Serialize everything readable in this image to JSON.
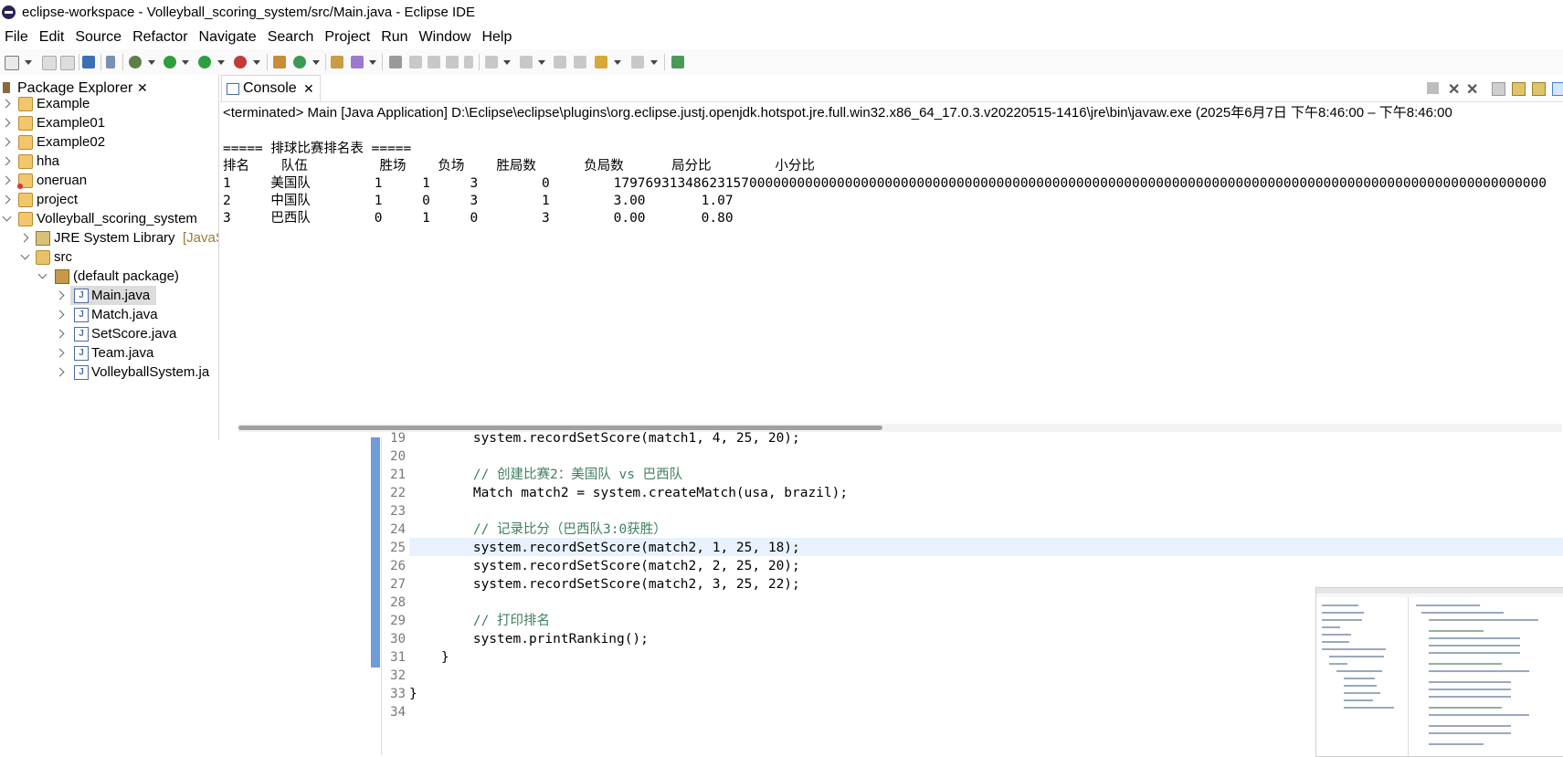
{
  "window": {
    "title": "eclipse-workspace - Volleyball_scoring_system/src/Main.java - Eclipse IDE"
  },
  "menu": [
    "File",
    "Edit",
    "Source",
    "Refactor",
    "Navigate",
    "Search",
    "Project",
    "Run",
    "Window",
    "Help"
  ],
  "package_explorer": {
    "tab_label": "Package Explorer",
    "items": [
      {
        "label": "Example",
        "icon": "project-icon"
      },
      {
        "label": "Example01",
        "icon": "project-icon"
      },
      {
        "label": "Example02",
        "icon": "project-icon"
      },
      {
        "label": "hha",
        "icon": "project-icon"
      },
      {
        "label": "oneruan",
        "icon": "project-error-icon"
      },
      {
        "label": "project",
        "icon": "project-icon"
      },
      {
        "label": "Volleyball_scoring_system",
        "icon": "project-icon"
      },
      {
        "label": "JRE System Library",
        "suffix": "[JavaS",
        "icon": "library-icon"
      },
      {
        "label": "src",
        "icon": "source-folder-icon"
      },
      {
        "label": "(default package)",
        "icon": "package-icon"
      },
      {
        "label": "Main.java",
        "icon": "java-file-icon"
      },
      {
        "label": "Match.java",
        "icon": "java-file-icon"
      },
      {
        "label": "SetScore.java",
        "icon": "java-file-icon"
      },
      {
        "label": "Team.java",
        "icon": "java-file-icon"
      },
      {
        "label": "VolleyballSystem.ja",
        "icon": "java-file-icon"
      }
    ]
  },
  "console": {
    "tab_label": "Console",
    "terminated": "<terminated> Main [Java Application] D:\\Eclipse\\eclipse\\plugins\\org.eclipse.justj.openjdk.hotspot.jre.full.win32.x86_64_17.0.3.v20220515-1416\\jre\\bin\\javaw.exe  (2025年6月7日 下午8:46:00 – 下午8:46:00",
    "lines": [
      "===== 排球比赛排名表 =====",
      "排名    队伍         胜场    负场    胜局数      负局数      局分比        小分比",
      "1     美国队        1     1     3        0        179769313486231570000000000000000000000000000000000000000000000000000000000000000000000000000000000000000000000000000",
      "2     中国队        1     0     3        1        3.00       1.07",
      "3     巴西队        0     1     0        3        0.00       0.80"
    ]
  },
  "editor": {
    "line_numbers": [
      "19",
      "20",
      "21",
      "22",
      "23",
      "24",
      "25",
      "26",
      "27",
      "28",
      "29",
      "30",
      "31",
      "32",
      "33",
      "34"
    ],
    "lines": [
      "        system.recordSetScore(match1, 4, 25, 20);",
      "",
      "        // 创建比赛2：美国队 vs 巴西队",
      "        Match match2 = system.createMatch(usa, brazil);",
      "",
      "        // 记录比分（巴西队3:0获胜）",
      "        system.recordSetScore(match2, 1, 25, 18);",
      "        system.recordSetScore(match2, 2, 25, 20);",
      "        system.recordSetScore(match2, 3, 25, 22);",
      "",
      "        // 打印排名",
      "        system.printRanking();",
      "    }",
      "",
      "}",
      ""
    ]
  },
  "colors": {
    "comment": "#3f7f5f",
    "current_line": "#e8f2fe",
    "change_bar": "#6f9bd7"
  }
}
